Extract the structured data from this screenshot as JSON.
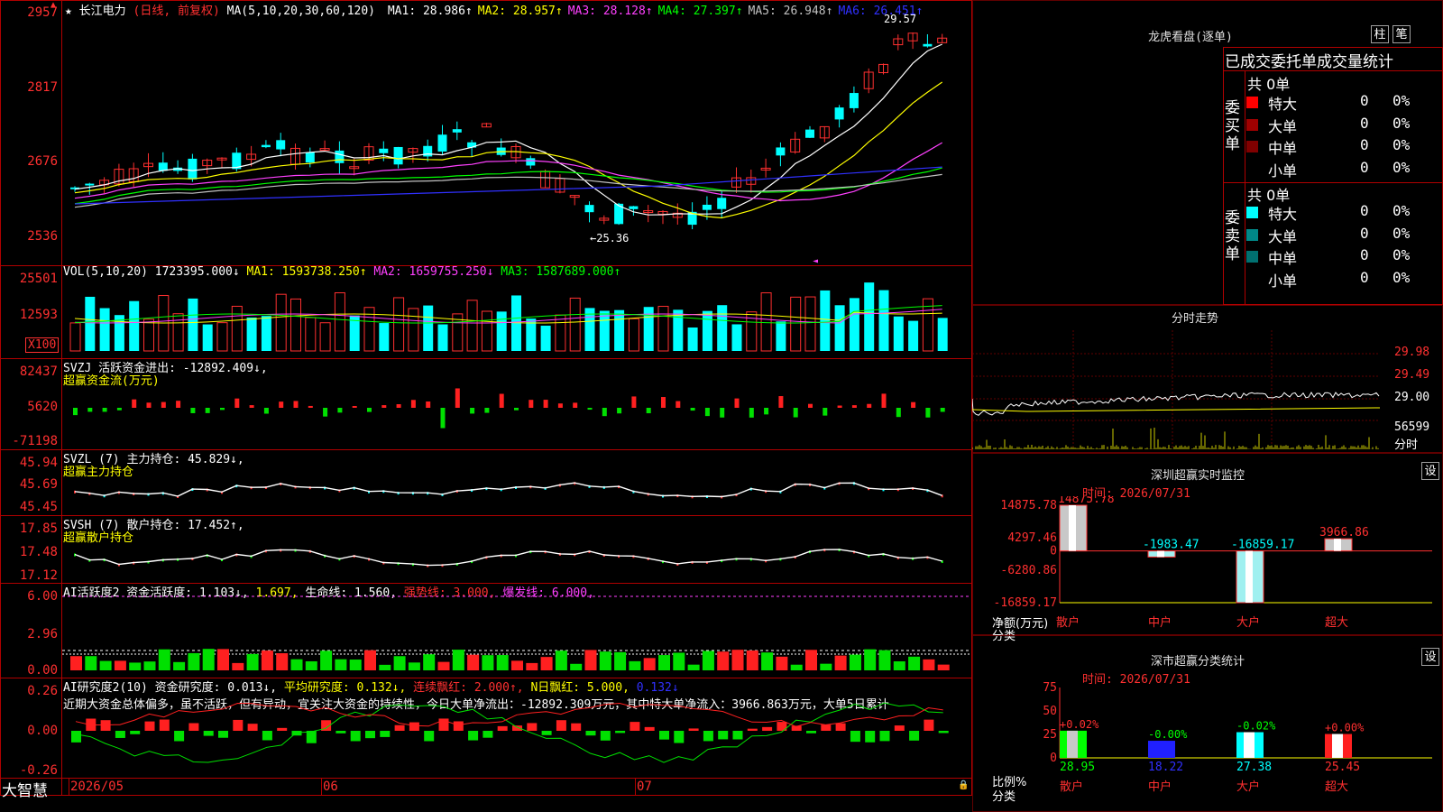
{
  "stock": {
    "name": "长江电力",
    "mode": "(日线, 前复权)",
    "ma_label": "MA(5,10,20,30,60,120)",
    "ma": [
      {
        "label": "MA1:",
        "value": "28.986↑",
        "color": "#ffffff"
      },
      {
        "label": "MA2:",
        "value": "28.957↑",
        "color": "#ffff00"
      },
      {
        "label": "MA3:",
        "value": "28.128↑",
        "color": "#ff40ff"
      },
      {
        "label": "MA4:",
        "value": "27.397↑",
        "color": "#00ff00"
      },
      {
        "label": "MA5:",
        "value": "26.948↑",
        "color": "#c0c0c0"
      },
      {
        "label": "MA6:",
        "value": "26.451↑",
        "color": "#3030ff"
      }
    ],
    "price_axis": [
      "2957",
      "2817",
      "2676",
      "2536"
    ],
    "high_mark": "29.57",
    "low_mark": "←25.36"
  },
  "vol": {
    "header": "VOL(5,10,20)",
    "value": "1723395.000↓",
    "ma1": "MA1: 1593738.250↑",
    "ma2": "MA2: 1659755.250↓",
    "ma3": "MA3: 1587689.000↑",
    "axis": [
      "25501",
      "12593"
    ],
    "unit": "X100"
  },
  "svzj": {
    "header": "SVZJ  活跃资金进出: -12892.409↓,",
    "sub": "超赢资金流(万元)",
    "axis": [
      "82437",
      "5620",
      "-71198"
    ]
  },
  "svzl": {
    "header": "SVZL (7) 主力持仓: 45.829↓,",
    "sub": "超赢主力持仓",
    "axis": [
      "45.94",
      "45.69",
      "45.45"
    ]
  },
  "svsh": {
    "header": "SVSH (7) 散户持仓: 17.452↑,",
    "sub": "超赢散户持仓",
    "axis": [
      "17.85",
      "17.48",
      "17.12"
    ]
  },
  "ai1": {
    "header_a": "AI活跃度2 资金活跃度: 1.103↓,",
    "header_b": "1.697,",
    "header_c": "生命线: 1.560,",
    "header_d": "强势线: 3.000,",
    "header_e": "爆发线: 6.000,",
    "axis": [
      "6.00",
      "2.96",
      "0.00"
    ]
  },
  "ai2": {
    "header_a": "AI研究度2(10) 资金研究度: 0.013↓,",
    "header_b": "平均研究度: 0.132↓,",
    "header_c": "连续飘红: 2.000↑,",
    "header_d": "N日飘红: 5.000,",
    "header_e": "0.132↓",
    "comment": "近期大资金总体偏多，虽不活跃，但有异动，宜关注大资金的持续性，今日大单净流出：-12892.309万元，其中特大单净流入：3966.863万元，大单5日累计",
    "axis": [
      "0.26",
      "0.00",
      "-0.26"
    ]
  },
  "bottom_axis": {
    "logo": "大智慧",
    "months": [
      "2026/05",
      "06",
      "07"
    ]
  },
  "dragon": {
    "title": "龙虎看盘(逐单)",
    "btn1": "柱",
    "btn2": "笔",
    "subtitle": "已成交委托单成交量统计",
    "buy_label": "委买单",
    "sell_label": "委卖单",
    "buy_total": "共 0单",
    "sell_total": "共 0单",
    "buy_rows": [
      {
        "name": "特大",
        "count": "0",
        "pct": "0%",
        "color": "#ff0000"
      },
      {
        "name": "大单",
        "count": "0",
        "pct": "0%",
        "color": "#a00000"
      },
      {
        "name": "中单",
        "count": "0",
        "pct": "0%",
        "color": "#800000"
      },
      {
        "name": "小单",
        "count": "0",
        "pct": "0%",
        "color": ""
      }
    ],
    "sell_rows": [
      {
        "name": "特大",
        "count": "0",
        "pct": "0%",
        "color": "#00ffff"
      },
      {
        "name": "大单",
        "count": "0",
        "pct": "0%",
        "color": "#008888"
      },
      {
        "name": "中单",
        "count": "0",
        "pct": "0%",
        "color": "#007070"
      },
      {
        "name": "小单",
        "count": "0",
        "pct": "0%",
        "color": ""
      }
    ]
  },
  "intraday": {
    "title": "分时走势",
    "axis": [
      "29.98",
      "29.49",
      "29.00",
      "56599",
      "分时"
    ]
  },
  "szmon": {
    "title": "深圳超赢实时监控",
    "set": "设",
    "time": "时间: 2026/07/31",
    "axis": [
      "14875.78",
      "4297.46",
      "0",
      "-6280.86",
      "-16859.17"
    ],
    "ylabel": "净额(万元)",
    "xlabel": "分类",
    "bars": [
      {
        "name": "散户",
        "value": 14875.78,
        "label": "14875.78"
      },
      {
        "name": "中户",
        "value": -1983.47,
        "label": "-1983.47"
      },
      {
        "name": "大户",
        "value": -16859.17,
        "label": "-16859.17"
      },
      {
        "name": "超大",
        "value": 3966.86,
        "label": "3966.86"
      }
    ]
  },
  "szcls": {
    "title": "深市超赢分类统计",
    "set": "设",
    "time": "时间: 2026/07/31",
    "axis": [
      "75",
      "50",
      "25",
      "0"
    ],
    "ylabel": "比例%",
    "xlabel": "分类",
    "bars": [
      {
        "name": "散户",
        "value": 28.95,
        "label": "28.95",
        "change": "+0.02%"
      },
      {
        "name": "中户",
        "value": 18.22,
        "label": "18.22",
        "change": "-0.00%"
      },
      {
        "name": "大户",
        "value": 27.38,
        "label": "27.38",
        "change": "-0.02%"
      },
      {
        "name": "超大",
        "value": 25.45,
        "label": "25.45",
        "change": "+0.00%"
      }
    ]
  }
}
